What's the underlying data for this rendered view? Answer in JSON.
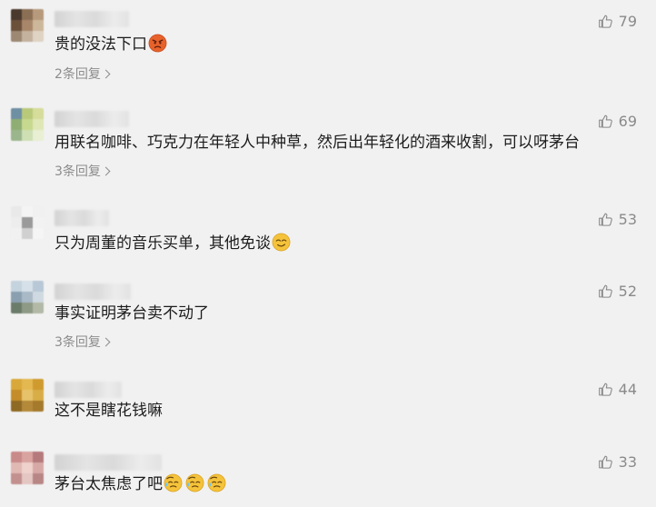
{
  "comments": [
    {
      "text": "贵的没法下口",
      "likes": "79",
      "replies": "2条回复",
      "emojis": [
        "angry-face"
      ],
      "has_reply": true
    },
    {
      "text": "用联名咖啡、巧克力在年轻人中种草，然后出年轻化的酒来收割，可以呀茅台",
      "likes": "69",
      "replies": "3条回复",
      "emojis": [],
      "has_reply": true
    },
    {
      "text": "只为周董的音乐买单，其他免谈",
      "likes": "53",
      "replies": "",
      "emojis": [
        "smirk-face"
      ],
      "has_reply": false
    },
    {
      "text": "事实证明茅台卖不动了",
      "likes": "52",
      "replies": "3条回复",
      "emojis": [],
      "has_reply": true
    },
    {
      "text": "这不是瞎花钱嘛",
      "likes": "44",
      "replies": "",
      "emojis": [],
      "has_reply": false
    },
    {
      "text": "茅台太焦虑了吧",
      "likes": "33",
      "replies": "",
      "emojis": [
        "sweat-face",
        "sweat-face",
        "sweat-face"
      ],
      "has_reply": false
    }
  ],
  "icons": {
    "like": "thumbs-up-icon",
    "reply_arrow": "chevron-right-icon"
  },
  "colors": {
    "background": "#f1f1f1",
    "text": "#1c1c1c",
    "meta": "#8a8a8a",
    "emoji_yellow": "#f5c33b",
    "emoji_angry": "#e8622c"
  }
}
